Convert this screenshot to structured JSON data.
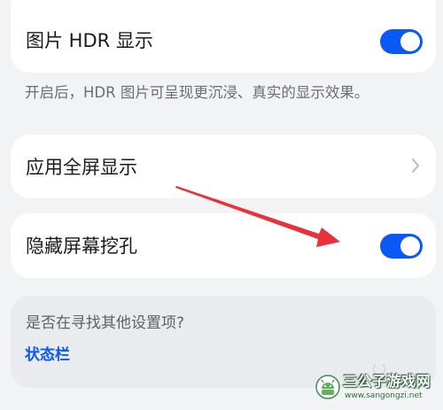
{
  "settings": {
    "hdr": {
      "label": "图片 HDR 显示",
      "enabled": true
    },
    "hdr_hint": "开启后，HDR 图片可呈现更沉浸、真实的显示效果。",
    "fullscreen": {
      "label": "应用全屏显示"
    },
    "hide_notch": {
      "label": "隐藏屏幕挖孔",
      "enabled": true
    }
  },
  "search": {
    "question": "是否在寻找其他设置项?",
    "link": "状态栏"
  },
  "watermark": {
    "title": "三公子游戏网",
    "url": "www.sangongzi.net"
  },
  "colors": {
    "accent": "#0a59f7",
    "background": "#f1f3f5",
    "card": "#ffffff",
    "annotation_arrow": "#e8313a"
  },
  "icons": {
    "fullscreen_chevron": "chevron-right-icon",
    "annotation": "red-arrow-icon",
    "logo": "android-robot-icon"
  }
}
